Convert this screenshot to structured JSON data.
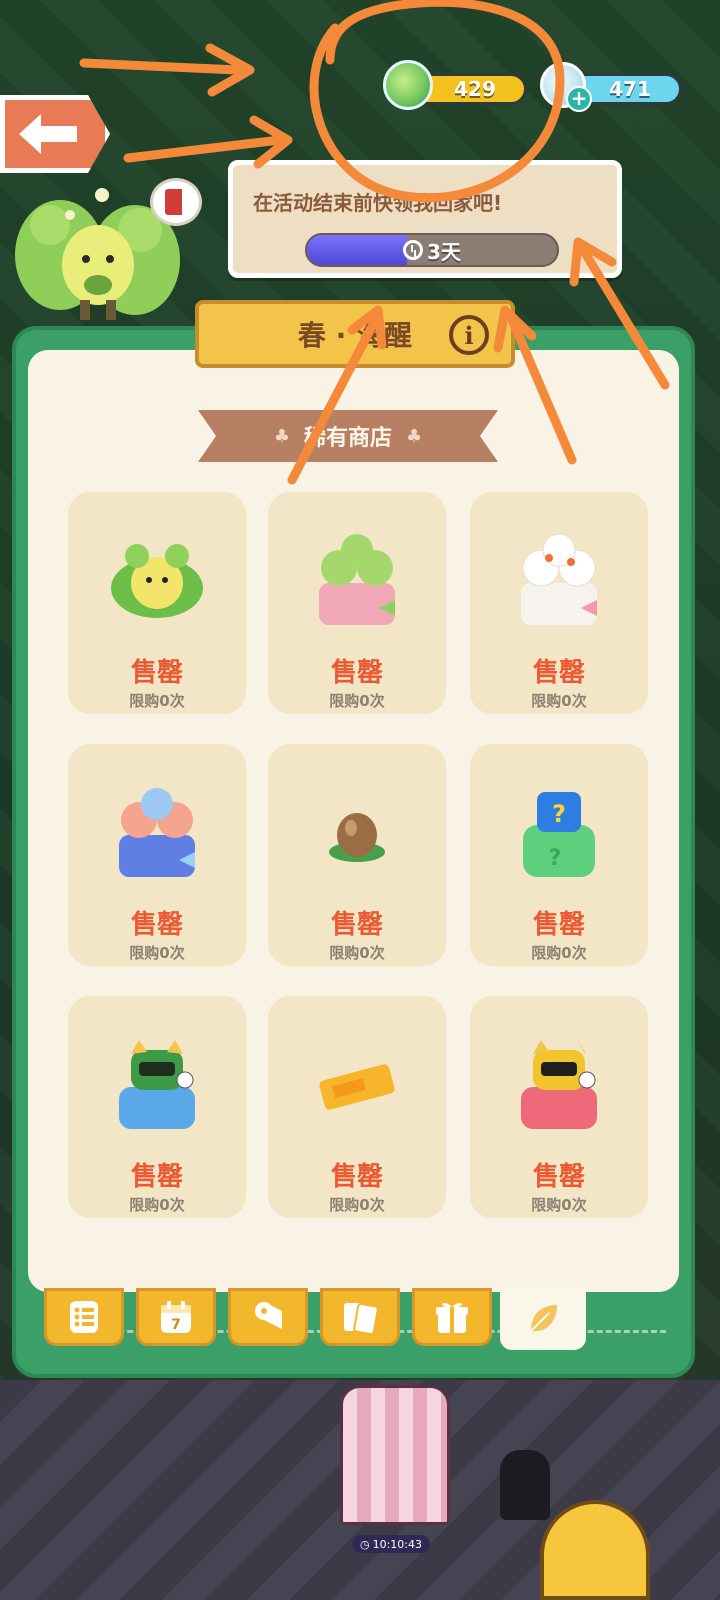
{
  "top_bar": {
    "currency_one": {
      "icon": "leaf-creature-icon",
      "value": "429"
    },
    "currency_two": {
      "icon": "cloud-creature-icon",
      "value": "471"
    }
  },
  "speech": {
    "text": "在活动结束前快领我回家吧!",
    "timer_label": "3天",
    "timer_progress": 0.4
  },
  "panel": {
    "title": "春 · 海醒",
    "section": "稀有商店"
  },
  "items": [
    {
      "icon": "green-bush-mascot-icon",
      "price": "售罄",
      "limit": "限购0次"
    },
    {
      "icon": "green-gift-basket-icon",
      "price": "售罄",
      "limit": "限购0次"
    },
    {
      "icon": "white-gift-basket-icon",
      "price": "售罄",
      "limit": "限购0次"
    },
    {
      "icon": "blue-gift-basket-icon",
      "price": "售罄",
      "limit": "限购0次"
    },
    {
      "icon": "seed-icon",
      "price": "售罄",
      "limit": "限购0次"
    },
    {
      "icon": "mystery-bag-icon",
      "price": "售罄",
      "limit": "限购0次"
    },
    {
      "icon": "blue-robot-cat-icon",
      "price": "售罄",
      "limit": "限购0次"
    },
    {
      "icon": "ticket-icon",
      "price": "售罄",
      "limit": "限购0次"
    },
    {
      "icon": "red-robot-cat-icon",
      "price": "售罄",
      "limit": "限购0次"
    }
  ],
  "tabs": [
    {
      "icon": "list-icon",
      "active": false
    },
    {
      "icon": "calendar-icon",
      "label": "7",
      "active": false
    },
    {
      "icon": "roll-icon",
      "active": false
    },
    {
      "icon": "cards-icon",
      "active": false
    },
    {
      "icon": "gift-icon",
      "active": false
    },
    {
      "icon": "leaf-icon",
      "active": true
    }
  ],
  "bottom_timer": "10:10:43",
  "colors": {
    "panel_green": "#3aa068",
    "price_red": "#ec5a33",
    "tab_yellow": "#f3b72b",
    "annotation_orange": "#f5893a"
  }
}
